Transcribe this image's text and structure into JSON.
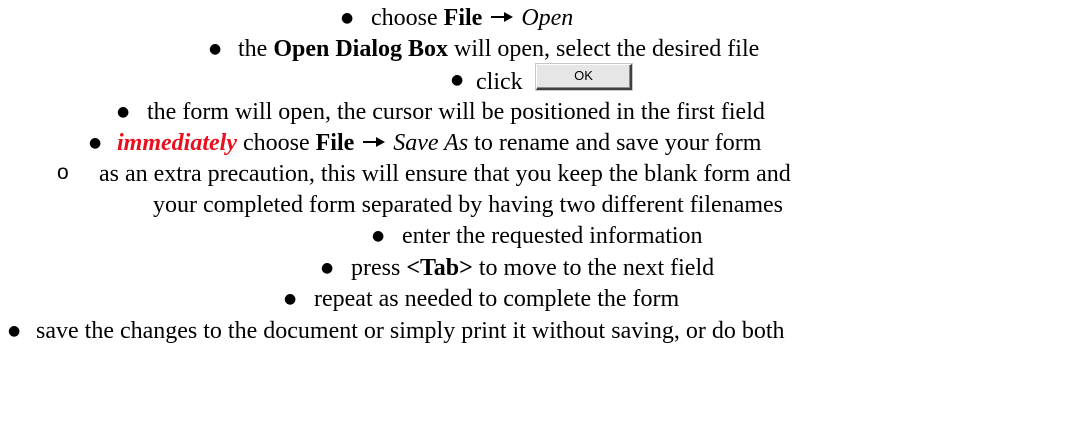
{
  "steps": {
    "open_file": {
      "prefix": "choose ",
      "menu": "File",
      "item": "Open"
    },
    "open_dialog": {
      "prefix": "the ",
      "name": "Open Dialog Box",
      "suffix": " will open, select the desired file"
    },
    "click_ok": {
      "prefix": "click",
      "button_label": "OK"
    },
    "form_opens": {
      "text": "the form will open, the cursor will be positioned in the first field"
    },
    "save_as": {
      "emphasis": "immediately",
      "mid": " choose ",
      "menu": "File",
      "item": "Save As",
      "suffix": " to rename and save your form"
    },
    "precaution": {
      "line1": "as an extra precaution, this will ensure that you keep the blank form and",
      "line2": "your completed form separated by having two different filenames"
    },
    "enter_info": {
      "text": "enter the requested information"
    },
    "press_tab": {
      "prefix": "press ",
      "key": "<Tab>",
      "suffix": " to move to the next field"
    },
    "repeat": {
      "text": "repeat as needed to complete the form"
    },
    "save_changes": {
      "text": "save the changes to the document or simply print it without saving, or do both"
    }
  },
  "icons": {
    "menu_arrow": "right-arrow-icon",
    "bullet": "filled-circle-bullet",
    "sub_bullet": "hollow-circle-bullet"
  },
  "colors": {
    "text": "#000000",
    "emphasis": "#e8101e",
    "button_face": "#e6e6e6"
  }
}
